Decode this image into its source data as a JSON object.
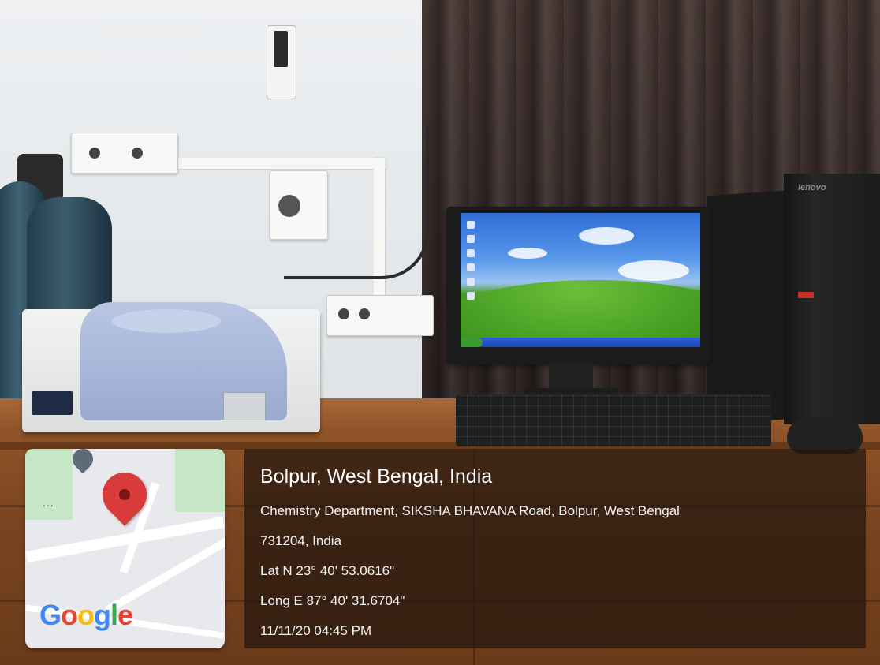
{
  "photo": {
    "scene": "laboratory bench with thermal analysis instrument and desktop computer",
    "brand_text": "lenovo"
  },
  "location_stamp": {
    "city_line": "Bolpur, West Bengal, India",
    "address_line_1": "Chemistry Department, SIKSHA BHAVANA Road, Bolpur, West Bengal",
    "address_line_2": "731204, India",
    "latitude": "Lat N 23° 40' 53.0616\"",
    "longitude": "Long E 87° 40' 31.6704\"",
    "timestamp": "11/11/20 04:45 PM"
  },
  "map": {
    "logo_parts": [
      "G",
      "o",
      "o",
      "g",
      "l",
      "e"
    ],
    "more_glyph": "...",
    "pin_color": "#d93a3a",
    "park_color": "#c6e7c6"
  },
  "colors": {
    "panel_background": "rgba(34,22,14,0.72)",
    "text": "#ffffff"
  }
}
